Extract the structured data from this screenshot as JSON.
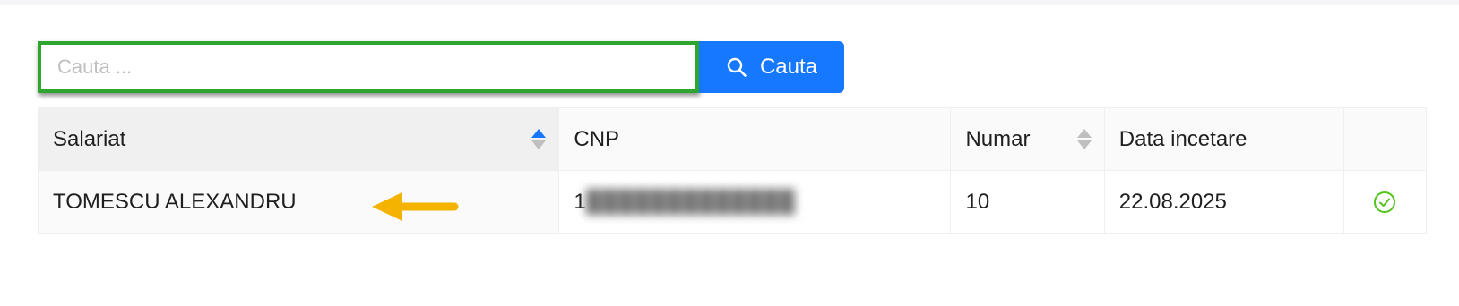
{
  "search": {
    "placeholder": "Cauta ...",
    "button_label": "Cauta",
    "button_icon": "search-icon"
  },
  "table": {
    "columns": [
      {
        "label": "Salariat",
        "sortable": true,
        "sort": "ascending"
      },
      {
        "label": "CNP",
        "sortable": false
      },
      {
        "label": "Numar",
        "sortable": true
      },
      {
        "label": "Data incetare",
        "sortable": false
      },
      {
        "label": "",
        "sortable": false
      }
    ],
    "rows": [
      {
        "salariat": "TOMESCU ALEXANDRU",
        "cnp": "1",
        "numar": "10",
        "data_incetare": "22.08.2025",
        "status_icon": "check-circle-icon"
      }
    ]
  },
  "colors": {
    "accent": "#1677ff",
    "highlight_border": "#2ea52e",
    "annotation_arrow": "#f5b301",
    "check": "#52c41a"
  }
}
